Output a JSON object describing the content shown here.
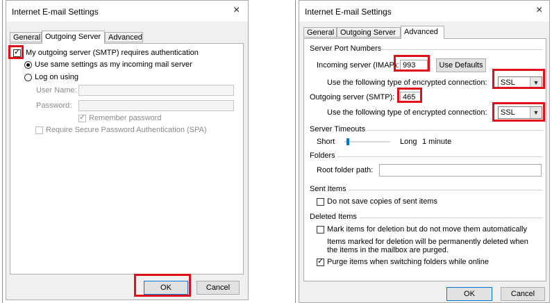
{
  "left_dialog": {
    "title": "Internet E-mail Settings",
    "close_glyph": "×",
    "tabs": [
      {
        "label": "General",
        "active": false
      },
      {
        "label": "Outgoing Server",
        "active": true
      },
      {
        "label": "Advanced",
        "active": false
      }
    ],
    "smtp_auth_label": "My outgoing server (SMTP) requires authentication",
    "smtp_auth_checked": true,
    "radio_same_label": "Use same settings as my incoming mail server",
    "radio_logon_label": "Log on using",
    "user_name_label": "User Name:",
    "user_name_value": "",
    "password_label": "Password:",
    "password_value": "",
    "remember_label": "Remember password",
    "spa_label": "Require Secure Password Authentication (SPA)",
    "ok_label": "OK",
    "cancel_label": "Cancel"
  },
  "right_dialog": {
    "title": "Internet E-mail Settings",
    "close_glyph": "×",
    "tabs": [
      {
        "label": "General",
        "active": false
      },
      {
        "label": "Outgoing Server",
        "active": false
      },
      {
        "label": "Advanced",
        "active": true
      }
    ],
    "ports_section": "Server Port Numbers",
    "incoming_label": "Incoming server (IMAP):",
    "incoming_value": "993",
    "use_defaults_label": "Use Defaults",
    "encrypt_label_1": "Use the following type of encrypted connection:",
    "encrypt_value_1": "SSL",
    "outgoing_label": "Outgoing server (SMTP):",
    "outgoing_value": "465",
    "encrypt_label_2": "Use the following type of encrypted connection:",
    "encrypt_value_2": "SSL",
    "timeouts_section": "Server Timeouts",
    "short_label": "Short",
    "long_label": "Long",
    "timeout_value": "1 minute",
    "folders_section": "Folders",
    "root_folder_label": "Root folder path:",
    "root_folder_value": "",
    "sent_section": "Sent Items",
    "no_save_label": "Do not save copies of sent items",
    "deleted_section": "Deleted Items",
    "mark_delete_label": "Mark items for deletion but do not move them automatically",
    "purge_note_line1": "Items marked for deletion will be permanently deleted when",
    "purge_note_line2": "the items in the mailbox are purged.",
    "purge_label": "Purge items when switching folders while online",
    "ok_label": "OK",
    "cancel_label": "Cancel"
  },
  "colors": {
    "highlight": "#e0101a",
    "dialog_bg": "#f0f0f0",
    "panel_bg": "#ffffff",
    "default_button_border": "#0078d7"
  }
}
